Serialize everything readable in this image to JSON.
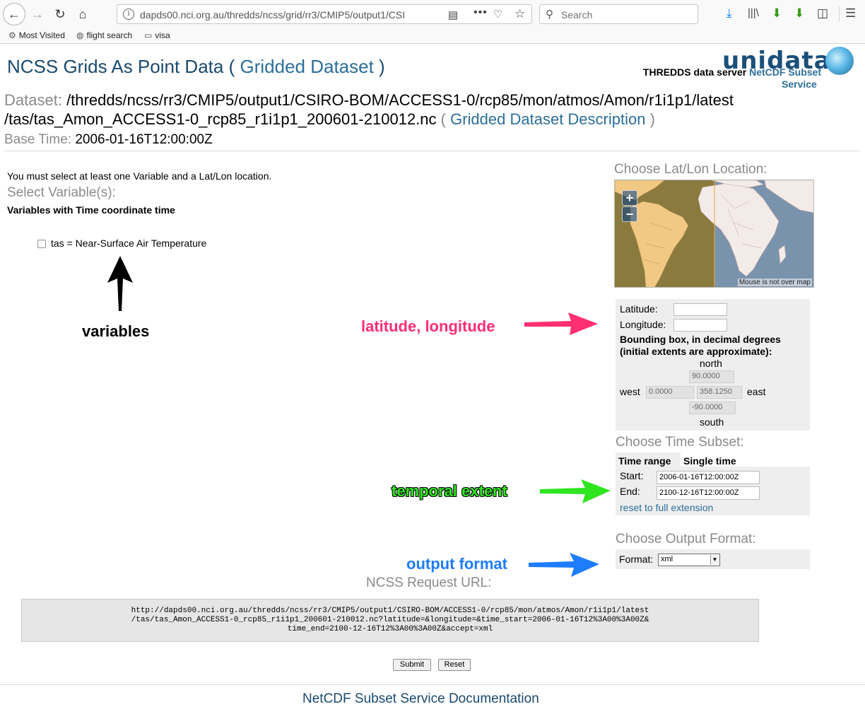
{
  "browser": {
    "url": "dapds00.nci.org.au/thredds/ncss/grid/rr3/CMIP5/output1/CSI",
    "search_placeholder": "Search",
    "bookmarks": [
      "Most Visited",
      "flight search",
      "visa"
    ]
  },
  "header": {
    "title": "NCSS Grids As Point Data",
    "title_open": "(",
    "title_link": "Gridded Dataset",
    "title_close": ")",
    "logo_text": "unidata",
    "server_prefix": "THREDDS data server",
    "server_link_part1": "NetCDF Subset",
    "server_link_part2": "Service",
    "dataset_label": "Dataset:",
    "dataset_path_line1": "/thredds/ncss/rr3/CMIP5/output1/CSIRO-BOM/ACCESS1-0/rcp85/mon/atmos/Amon/r1i1p1/latest",
    "dataset_path_line2": "/tas/tas_Amon_ACCESS1-0_rcp85_r1i1p1_200601-210012.nc",
    "description_open": "(",
    "description_link": "Gridded Dataset Description",
    "description_close": ")",
    "basetime_label": "Base Time:",
    "basetime_value": "2006-01-16T12:00:00Z"
  },
  "left": {
    "must_select": "You must select at least one Variable and a Lat/Lon location.",
    "select_heading": "Select Variable(s):",
    "vars_with_time": "Variables with Time coordinate time",
    "variable_label": "tas = Near-Surface Air Temperature"
  },
  "annotations": {
    "variables": "variables",
    "latlon": "latitude, longitude",
    "temporal": "temporal extent",
    "output": "output format"
  },
  "latlon": {
    "heading": "Choose Lat/Lon Location:",
    "zoom_in": "+",
    "zoom_out": "−",
    "mouse_status": "Mouse is not over map",
    "latitude_label": "Latitude:",
    "longitude_label": "Longitude:",
    "bbox_line1": "Bounding box, in decimal degrees",
    "bbox_line2": "(initial extents are approximate):",
    "north_label": "north",
    "north_value": "90.0000",
    "west_label": "west",
    "west_value": "0.0000",
    "east_value": "358.1250",
    "east_label": "east",
    "south_value": "-90.0000",
    "south_label": "south"
  },
  "time": {
    "heading": "Choose Time Subset:",
    "tab_range": "Time range",
    "tab_single": "Single time",
    "start_label": "Start:",
    "start_value": "2006-01-16T12:00:00Z",
    "end_label": "End:",
    "end_value": "2100-12-16T12:00:00Z",
    "reset_link": "reset to full extension"
  },
  "output": {
    "heading": "Choose Output Format:",
    "format_label": "Format:",
    "format_value": "xml"
  },
  "request": {
    "heading": "NCSS Request URL:",
    "line1": "http://dapds00.nci.org.au/thredds/ncss/rr3/CMIP5/output1/CSIRO-BOM/ACCESS1-0/rcp85/mon/atmos/Amon/r1i1p1/latest",
    "line2": "/tas/tas_Amon_ACCESS1-0_rcp85_r1i1p1_200601-210012.nc?latitude=&longitude=&time_start=2006-01-16T12%3A00%3A00Z&",
    "line3": "time_end=2100-12-16T12%3A00%3A00Z&accept=xml"
  },
  "buttons": {
    "submit": "Submit",
    "reset": "Reset"
  },
  "footer": {
    "doc_link": "NetCDF Subset Service Documentation"
  },
  "colors": {
    "accent_link": "#2c6e9a",
    "annot_latlon": "#ff2f72",
    "annot_temporal": "#2ee620",
    "annot_output": "#1e7cff"
  }
}
